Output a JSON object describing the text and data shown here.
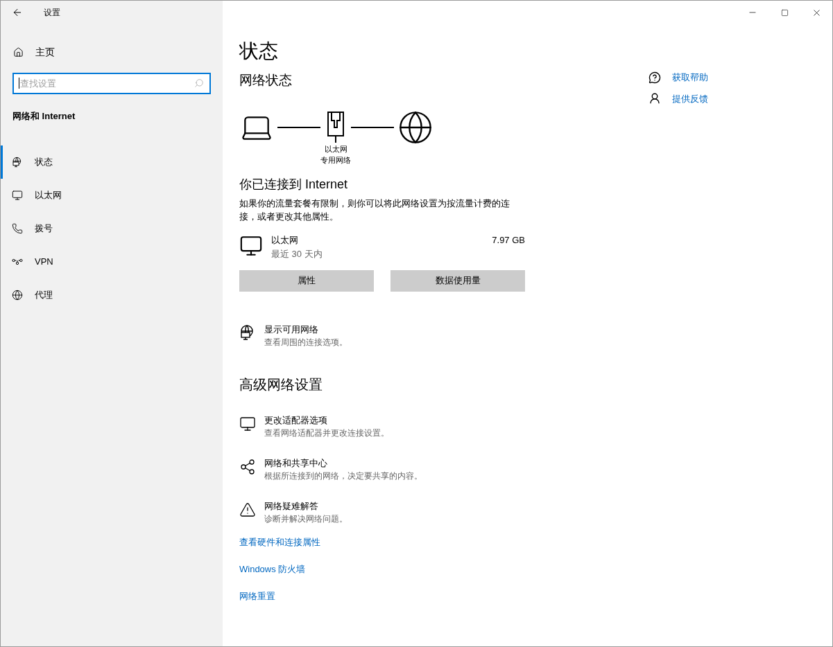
{
  "window": {
    "title": "设置"
  },
  "sidebar": {
    "home": "主页",
    "search": {
      "placeholder": "查找设置"
    },
    "section": "网络和 Internet",
    "items": [
      {
        "label": "状态",
        "selected": true
      },
      {
        "label": "以太网",
        "selected": false
      },
      {
        "label": "拨号",
        "selected": false
      },
      {
        "label": "VPN",
        "selected": false
      },
      {
        "label": "代理",
        "selected": false
      }
    ]
  },
  "main": {
    "title": "状态",
    "network_status": {
      "heading": "网络状态",
      "adapter": "以太网",
      "profile": "专用网络"
    },
    "connection": {
      "heading": "你已连接到 Internet",
      "description": "如果你的流量套餐有限制，则你可以将此网络设置为按流量计费的连接，或者更改其他属性。",
      "usage": {
        "name": "以太网",
        "period": "最近 30 天内",
        "amount": "7.97 GB"
      },
      "buttons": [
        "属性",
        "数据使用量"
      ]
    },
    "show_networks": {
      "title": "显示可用网络",
      "subtitle": "查看周围的连接选项。"
    },
    "advanced": {
      "heading": "高级网络设置",
      "items": [
        {
          "title": "更改适配器选项",
          "subtitle": "查看网络适配器并更改连接设置。"
        },
        {
          "title": "网络和共享中心",
          "subtitle": "根据所连接到的网络，决定要共享的内容。"
        },
        {
          "title": "网络疑难解答",
          "subtitle": "诊断并解决网络问题。"
        }
      ]
    },
    "links": [
      "查看硬件和连接属性",
      "Windows 防火墙",
      "网络重置"
    ]
  },
  "help": [
    "获取帮助",
    "提供反馈"
  ]
}
